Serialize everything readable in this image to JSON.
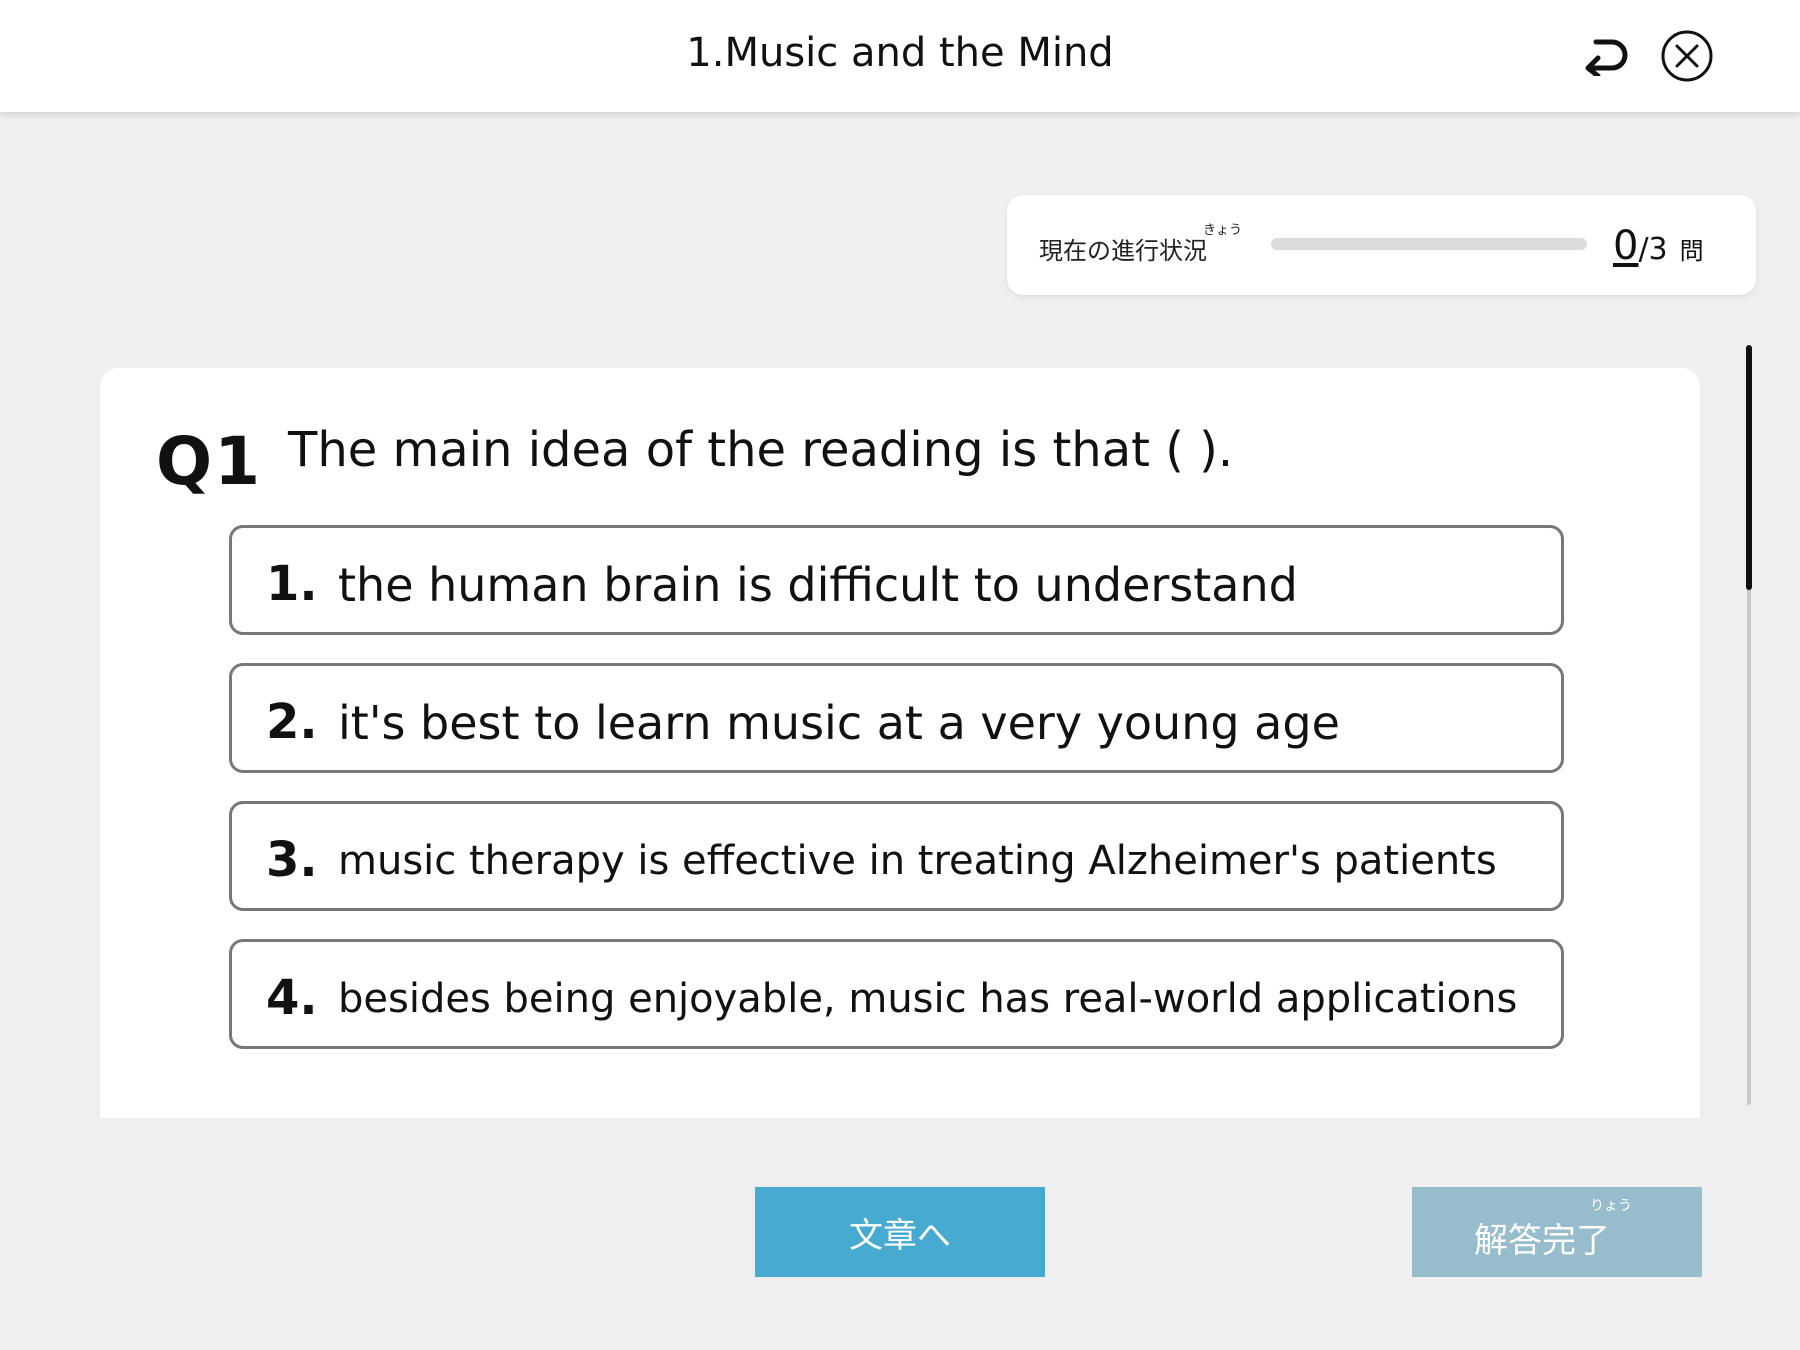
{
  "header": {
    "title": "1.Music and the Mind",
    "back_icon": "return-arrow-icon",
    "close_icon": "close-circle-icon"
  },
  "progress": {
    "label": "現在の進行状況",
    "ruby": "きょう",
    "answered": "0",
    "total": "/3",
    "unit": "問",
    "fraction": 0
  },
  "question": {
    "label": "Q1",
    "text": "The main idea of the reading is that (          ).",
    "options": [
      {
        "number": "1.",
        "text": "the human brain is difficult to understand"
      },
      {
        "number": "2.",
        "text": "it's best to learn music at a very young age"
      },
      {
        "number": "3.",
        "text": "music therapy is effective in treating Alzheimer's patients"
      },
      {
        "number": "4.",
        "text": "besides being enjoyable, music has real-world applications"
      }
    ]
  },
  "buttons": {
    "passage": "文章へ",
    "complete": "解答完了",
    "complete_ruby": "りょう"
  },
  "colors": {
    "accent": "#46aad1",
    "disabled": "#97bccb",
    "background": "#efefef"
  }
}
